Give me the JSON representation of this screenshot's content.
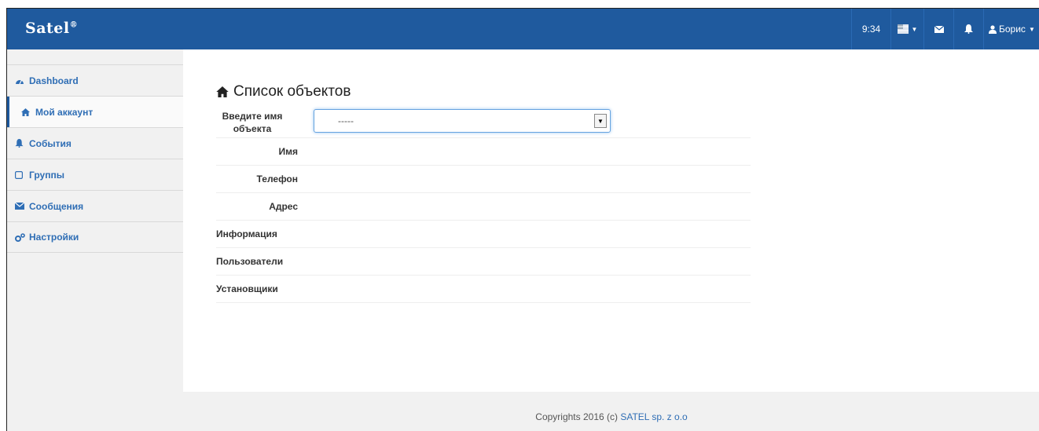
{
  "navbar": {
    "brand": "Satel",
    "time": "9:34",
    "user_label": "Борис"
  },
  "sidebar": {
    "items": [
      {
        "label": "Dashboard",
        "icon": "dashboard-icon"
      },
      {
        "label": "Мой аккаунт",
        "icon": "home-icon"
      },
      {
        "label": "События",
        "icon": "bell-icon"
      },
      {
        "label": "Группы",
        "icon": "square-icon"
      },
      {
        "label": "Сообщения",
        "icon": "envelope-icon"
      },
      {
        "label": "Настройки",
        "icon": "gears-icon"
      }
    ]
  },
  "main": {
    "title": "Список объектов",
    "object_select": {
      "label": "Введите имя объекта",
      "value": "-----"
    },
    "fields": [
      {
        "label": "Имя"
      },
      {
        "label": "Телефон"
      },
      {
        "label": "Адрес"
      },
      {
        "label": "Информация"
      },
      {
        "label": "Пользователи"
      },
      {
        "label": "Установщики"
      }
    ]
  },
  "footer": {
    "text": "Copyrights 2016 (c) ",
    "link": "SATEL sp. z o.o"
  },
  "colors": {
    "navbar": "#1f5a9e",
    "link": "#2f6eb5",
    "background": "#f1f1f1"
  }
}
